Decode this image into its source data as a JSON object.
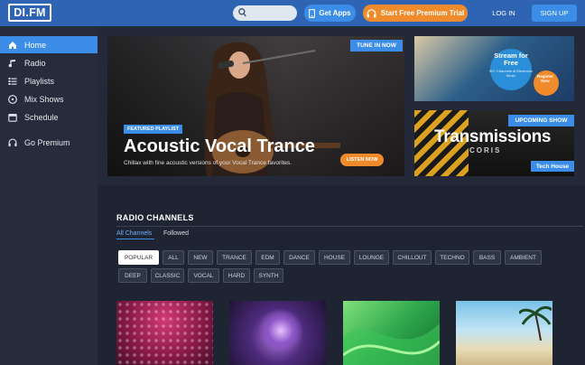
{
  "header": {
    "logo": "DI.FM",
    "search": {
      "placeholder": ""
    },
    "get_apps": "Get Apps",
    "premium_trial": "Start Free Premium Trial",
    "login": "LOG IN",
    "signup": "SIGN UP"
  },
  "sidebar": {
    "items": [
      {
        "label": "Home",
        "icon": "home-icon",
        "active": true
      },
      {
        "label": "Radio",
        "icon": "music-note-icon",
        "active": false
      },
      {
        "label": "Playlists",
        "icon": "list-icon",
        "active": false
      },
      {
        "label": "Mix Shows",
        "icon": "disc-icon",
        "active": false
      },
      {
        "label": "Schedule",
        "icon": "calendar-icon",
        "active": false
      },
      {
        "label": "Go Premium",
        "icon": "headphones-icon",
        "active": false
      }
    ]
  },
  "featured": {
    "badge": "TUNE IN NOW",
    "label": "FEATURED PLAYLIST",
    "title": "Acoustic Vocal Trance",
    "description": "Chillax with fine acoustic versions of your Vocal Trance favorites.",
    "cta": "LISTEN NOW"
  },
  "promo": {
    "title": "Stream for Free",
    "subtitle": "90+ Channels of Electronic Music",
    "cta": "Register Now"
  },
  "upcoming": {
    "badge": "UPCOMING SHOW",
    "title": "Transmissions",
    "subtitle": "CORIS",
    "genre": "Tech House"
  },
  "channels": {
    "title": "RADIO CHANNELS",
    "tabs": [
      "All Channels",
      "Followed"
    ],
    "genres_row1": [
      "POPULAR",
      "ALL",
      "NEW",
      "TRANCE",
      "EDM",
      "DANCE",
      "HOUSE",
      "LOUNGE",
      "CHILLOUT",
      "TECHNO",
      "BASS",
      "AMBIENT"
    ],
    "genres_row2": [
      "DEEP",
      "CLASSIC",
      "VOCAL",
      "HARD",
      "SYNTH"
    ],
    "active_genre": "POPULAR"
  },
  "colors": {
    "header_blue": "#2f64b4",
    "accent_blue": "#3b8de8",
    "accent_orange": "#f08b2c",
    "background": "#1f2433",
    "sidebar": "#262c3b"
  }
}
